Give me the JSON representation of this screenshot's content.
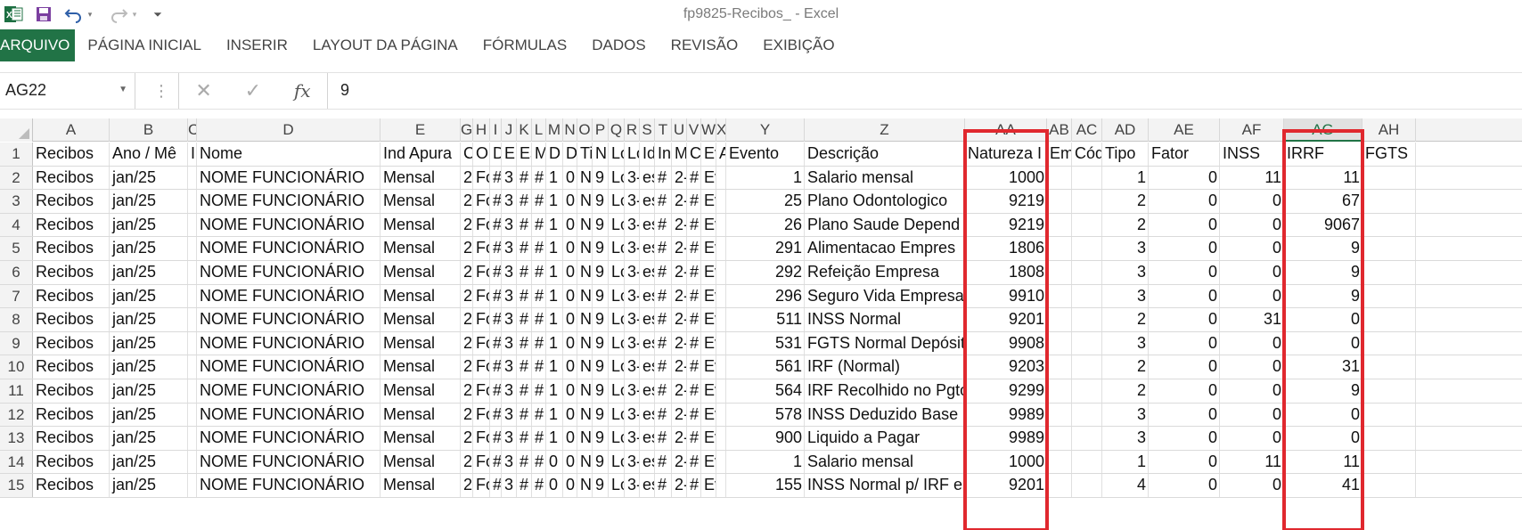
{
  "window": {
    "title": "fp9825-Recibos_ - Excel"
  },
  "qat_icons": [
    "excel-logo-icon",
    "save-icon",
    "undo-icon",
    "redo-icon",
    "customize-qat-icon"
  ],
  "ribbon_tabs": [
    "ARQUIVO",
    "PÁGINA INICIAL",
    "INSERIR",
    "LAYOUT DA PÁGINA",
    "FÓRMULAS",
    "DADOS",
    "REVISÃO",
    "EXIBIÇÃO"
  ],
  "formula_bar": {
    "name_box": "AG22",
    "fx_label": "fx",
    "value": "9"
  },
  "accent_color": "#217346",
  "highlight_color": "#e0282e",
  "columns": [
    "A",
    "B",
    "C",
    "D",
    "E",
    "G",
    "H",
    "I",
    "J",
    "K",
    "L",
    "M",
    "N",
    "O",
    "P",
    "Q",
    "R",
    "S",
    "T",
    "U",
    "V",
    "W",
    "X",
    "Y",
    "Z",
    "AA",
    "AB",
    "AC",
    "AD",
    "AE",
    "AF",
    "AG",
    "AH"
  ],
  "rows": [
    {
      "n": "1",
      "cells": [
        "Recibos",
        "Ano / Mê",
        "I",
        "Nome",
        "Ind Apura",
        "Cd",
        "O",
        "D",
        "Er",
        "Es",
        "M",
        "D",
        "D",
        "Ti",
        "N",
        "Lo",
        "Lo",
        "Id",
        "In",
        "M",
        "Ca",
        "Ev",
        "A",
        "Evento",
        "Descrição",
        "Natureza I",
        "Em",
        "Cód",
        "Tipo",
        "Fator",
        "INSS",
        "IRRF",
        "FGTS"
      ]
    },
    {
      "n": "2",
      "cells": [
        "Recibos",
        "jan/25",
        "",
        "NOME FUNCIONÁRIO",
        "Mensal",
        "2-",
        "Fo",
        "#",
        "3",
        "#",
        "#",
        "1",
        "0",
        "N",
        "9",
        "Lo",
        "3-",
        "es",
        "#",
        "2-",
        "#",
        "Eve",
        "",
        "1",
        "Salario mensal",
        "1000",
        "",
        "",
        "1",
        "0",
        "11",
        "11",
        ""
      ]
    },
    {
      "n": "3",
      "cells": [
        "Recibos",
        "jan/25",
        "",
        "NOME FUNCIONÁRIO",
        "Mensal",
        "2-",
        "Fo",
        "#",
        "3",
        "#",
        "#",
        "1",
        "0",
        "N",
        "9",
        "Lo",
        "3-",
        "es",
        "#",
        "2-",
        "#",
        "Eve",
        "",
        "25",
        "Plano Odontologico",
        "9219",
        "",
        "",
        "2",
        "0",
        "0",
        "67",
        ""
      ]
    },
    {
      "n": "4",
      "cells": [
        "Recibos",
        "jan/25",
        "",
        "NOME FUNCIONÁRIO",
        "Mensal",
        "2-",
        "Fo",
        "#",
        "3",
        "#",
        "#",
        "1",
        "0",
        "N",
        "9",
        "Lo",
        "3-",
        "es",
        "#",
        "2-",
        "#",
        "Eve",
        "",
        "26",
        "Plano Saude Depend",
        "9219",
        "",
        "",
        "2",
        "0",
        "0",
        "9067",
        ""
      ]
    },
    {
      "n": "5",
      "cells": [
        "Recibos",
        "jan/25",
        "",
        "NOME FUNCIONÁRIO",
        "Mensal",
        "2-",
        "Fo",
        "#",
        "3",
        "#",
        "#",
        "1",
        "0",
        "N",
        "9",
        "Lo",
        "3-",
        "es",
        "#",
        "2-",
        "#",
        "Eve",
        "",
        "291",
        "Alimentacao Empres",
        "1806",
        "",
        "",
        "3",
        "0",
        "0",
        "9",
        ""
      ]
    },
    {
      "n": "6",
      "cells": [
        "Recibos",
        "jan/25",
        "",
        "NOME FUNCIONÁRIO",
        "Mensal",
        "2-",
        "Fo",
        "#",
        "3",
        "#",
        "#",
        "1",
        "0",
        "N",
        "9",
        "Lo",
        "3-",
        "es",
        "#",
        "2-",
        "#",
        "Eve",
        "",
        "292",
        "Refeição Empresa",
        "1808",
        "",
        "",
        "3",
        "0",
        "0",
        "9",
        ""
      ]
    },
    {
      "n": "7",
      "cells": [
        "Recibos",
        "jan/25",
        "",
        "NOME FUNCIONÁRIO",
        "Mensal",
        "2-",
        "Fo",
        "#",
        "3",
        "#",
        "#",
        "1",
        "0",
        "N",
        "9",
        "Lo",
        "3-",
        "es",
        "#",
        "2-",
        "#",
        "Eve",
        "",
        "296",
        "Seguro Vida Empresa",
        "9910",
        "",
        "",
        "3",
        "0",
        "0",
        "9",
        ""
      ]
    },
    {
      "n": "8",
      "cells": [
        "Recibos",
        "jan/25",
        "",
        "NOME FUNCIONÁRIO",
        "Mensal",
        "2-",
        "Fo",
        "#",
        "3",
        "#",
        "#",
        "1",
        "0",
        "N",
        "9",
        "Lo",
        "3-",
        "es",
        "#",
        "2-",
        "#",
        "Eve",
        "",
        "511",
        "INSS Normal",
        "9201",
        "",
        "",
        "2",
        "0",
        "31",
        "0",
        ""
      ]
    },
    {
      "n": "9",
      "cells": [
        "Recibos",
        "jan/25",
        "",
        "NOME FUNCIONÁRIO",
        "Mensal",
        "2-",
        "Fo",
        "#",
        "3",
        "#",
        "#",
        "1",
        "0",
        "N",
        "9",
        "Lo",
        "3-",
        "es",
        "#",
        "2-",
        "#",
        "Eve",
        "",
        "531",
        "FGTS Normal Depósit",
        "9908",
        "",
        "",
        "3",
        "0",
        "0",
        "0",
        ""
      ]
    },
    {
      "n": "10",
      "cells": [
        "Recibos",
        "jan/25",
        "",
        "NOME FUNCIONÁRIO",
        "Mensal",
        "2-",
        "Fo",
        "#",
        "3",
        "#",
        "#",
        "1",
        "0",
        "N",
        "9",
        "Lo",
        "3-",
        "es",
        "#",
        "2-",
        "#",
        "Eve",
        "",
        "561",
        "IRF (Normal)",
        "9203",
        "",
        "",
        "2",
        "0",
        "0",
        "31",
        ""
      ]
    },
    {
      "n": "11",
      "cells": [
        "Recibos",
        "jan/25",
        "",
        "NOME FUNCIONÁRIO",
        "Mensal",
        "2-",
        "Fo",
        "#",
        "3",
        "#",
        "#",
        "1",
        "0",
        "N",
        "9",
        "Lo",
        "3-",
        "es",
        "#",
        "2-",
        "#",
        "Eve",
        "",
        "564",
        "IRF Recolhido no Pgto",
        "9299",
        "",
        "",
        "2",
        "0",
        "0",
        "9",
        ""
      ]
    },
    {
      "n": "12",
      "cells": [
        "Recibos",
        "jan/25",
        "",
        "NOME FUNCIONÁRIO",
        "Mensal",
        "2-",
        "Fo",
        "#",
        "3",
        "#",
        "#",
        "1",
        "0",
        "N",
        "9",
        "Lo",
        "3-",
        "es",
        "#",
        "2-",
        "#",
        "Eve",
        "",
        "578",
        "INSS Deduzido Base I",
        "9989",
        "",
        "",
        "3",
        "0",
        "0",
        "0",
        ""
      ]
    },
    {
      "n": "13",
      "cells": [
        "Recibos",
        "jan/25",
        "",
        "NOME FUNCIONÁRIO",
        "Mensal",
        "2-",
        "Fo",
        "#",
        "3",
        "#",
        "#",
        "1",
        "0",
        "N",
        "9",
        "Lo",
        "3-",
        "es",
        "#",
        "2-",
        "#",
        "Eve",
        "",
        "900",
        "Liquido a Pagar",
        "9989",
        "",
        "",
        "3",
        "0",
        "0",
        "0",
        ""
      ]
    },
    {
      "n": "14",
      "cells": [
        "Recibos",
        "jan/25",
        "",
        "NOME FUNCIONÁRIO",
        "Mensal",
        "2-",
        "Fo",
        "#",
        "3",
        "#",
        "#",
        "0",
        "0",
        "N",
        "9",
        "Lo",
        "3-",
        "es",
        "#",
        "2-",
        "#",
        "Eve",
        "",
        "1",
        "Salario mensal",
        "1000",
        "",
        "",
        "1",
        "0",
        "11",
        "11",
        ""
      ]
    },
    {
      "n": "15",
      "cells": [
        "Recibos",
        "jan/25",
        "",
        "NOME FUNCIONÁRIO",
        "Mensal",
        "2-",
        "Fo",
        "#",
        "3",
        "#",
        "#",
        "0",
        "0",
        "N",
        "9",
        "Lo",
        "3-",
        "es",
        "#",
        "2-",
        "#",
        "Eve",
        "",
        "155",
        "INSS Normal p/ IRF e",
        "9201",
        "",
        "",
        "4",
        "0",
        "0",
        "41",
        ""
      ]
    }
  ]
}
